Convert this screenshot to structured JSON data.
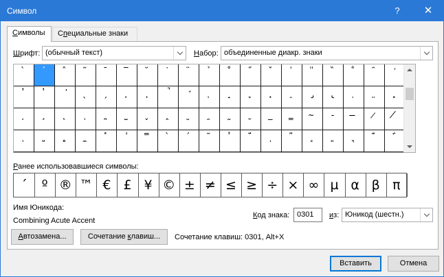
{
  "window": {
    "title": "Символ",
    "help_label": "?",
    "close_label": "✕"
  },
  "tabs": [
    {
      "label": "Символы",
      "mnemonic": "С",
      "rest": "имволы"
    },
    {
      "label": "Специальные знаки",
      "mnemonic": "п",
      "pre": "С",
      "rest": "ециальные знаки"
    }
  ],
  "font": {
    "label": "Шрифт:",
    "mnemonic": "Ш",
    "rest": "рифт:",
    "value": "(обычный текст)"
  },
  "subset": {
    "label": "Набор:",
    "mnemonic": "Н",
    "rest": "абор:",
    "value": "объединенные диакр. знаки"
  },
  "symbol_grid": {
    "selected_index": 1,
    "rows": [
      [
        "̀",
        "́",
        "̂",
        "̃",
        "̄",
        "̅",
        "̆",
        "̇",
        "̈",
        "̉",
        "̊",
        "̋",
        "̌",
        "̍",
        "̎",
        "̏",
        "̐",
        "̑",
        "̒"
      ],
      [
        "̓",
        "̔",
        "̕",
        "̖",
        "̗",
        "̘",
        "̙",
        "̚",
        "̛",
        "̜",
        "̝",
        "̞",
        "̟",
        "̠",
        "̡",
        "̢",
        "̣",
        "̤",
        "̥"
      ],
      [
        "̦",
        "̧",
        "̨",
        "̩",
        "̪",
        "̫",
        "̬",
        "̭",
        "̮",
        "̯",
        "̰",
        "̱",
        "̲",
        "̳",
        "̴",
        "̵",
        "̶",
        "̷",
        "̸"
      ],
      [
        "̹",
        "̺",
        "̻",
        "̼",
        "̽",
        "̾",
        "̿",
        "̀",
        "́",
        "͂",
        "̓",
        "̈́",
        "ͅ",
        "͆",
        "͇",
        "͈",
        "͉",
        "͊",
        "͋"
      ]
    ]
  },
  "recent": {
    "label": "Ранее использовавшиеся символы:",
    "mnemonic": "Р",
    "rest": "анее использовавшиеся символы:",
    "symbols": [
      "´",
      "º",
      "®",
      "™",
      "€",
      "£",
      "¥",
      "©",
      "±",
      "≠",
      "≤",
      "≥",
      "÷",
      "×",
      "∞",
      "µ",
      "α",
      "β",
      "π"
    ]
  },
  "unicode_name": {
    "label": "Имя Юникода:",
    "value": "Combining Acute Accent"
  },
  "char_code": {
    "label": "Код знака:",
    "mnemonic": "К",
    "rest": "од знака:",
    "value": "0301"
  },
  "from": {
    "label": "из:",
    "mnemonic": "и",
    "rest": "з:",
    "value": "Юникод (шестн.)"
  },
  "buttons": {
    "autocorrect": "Автозамена...",
    "autocorrect_mn": "А",
    "autocorrect_rest": "втозамена...",
    "shortcut_key": "Сочетание клавиш...",
    "shortcut_key_pre": "Сочетание ",
    "shortcut_key_mn": "к",
    "shortcut_key_rest": "лавиш...",
    "insert": "Вставить",
    "cancel": "Отмена"
  },
  "shortcut_text": "Сочетание клавиш: 0301, Alt+X",
  "colors": {
    "titlebar": "#2b79d7",
    "selection": "#3399ff"
  }
}
